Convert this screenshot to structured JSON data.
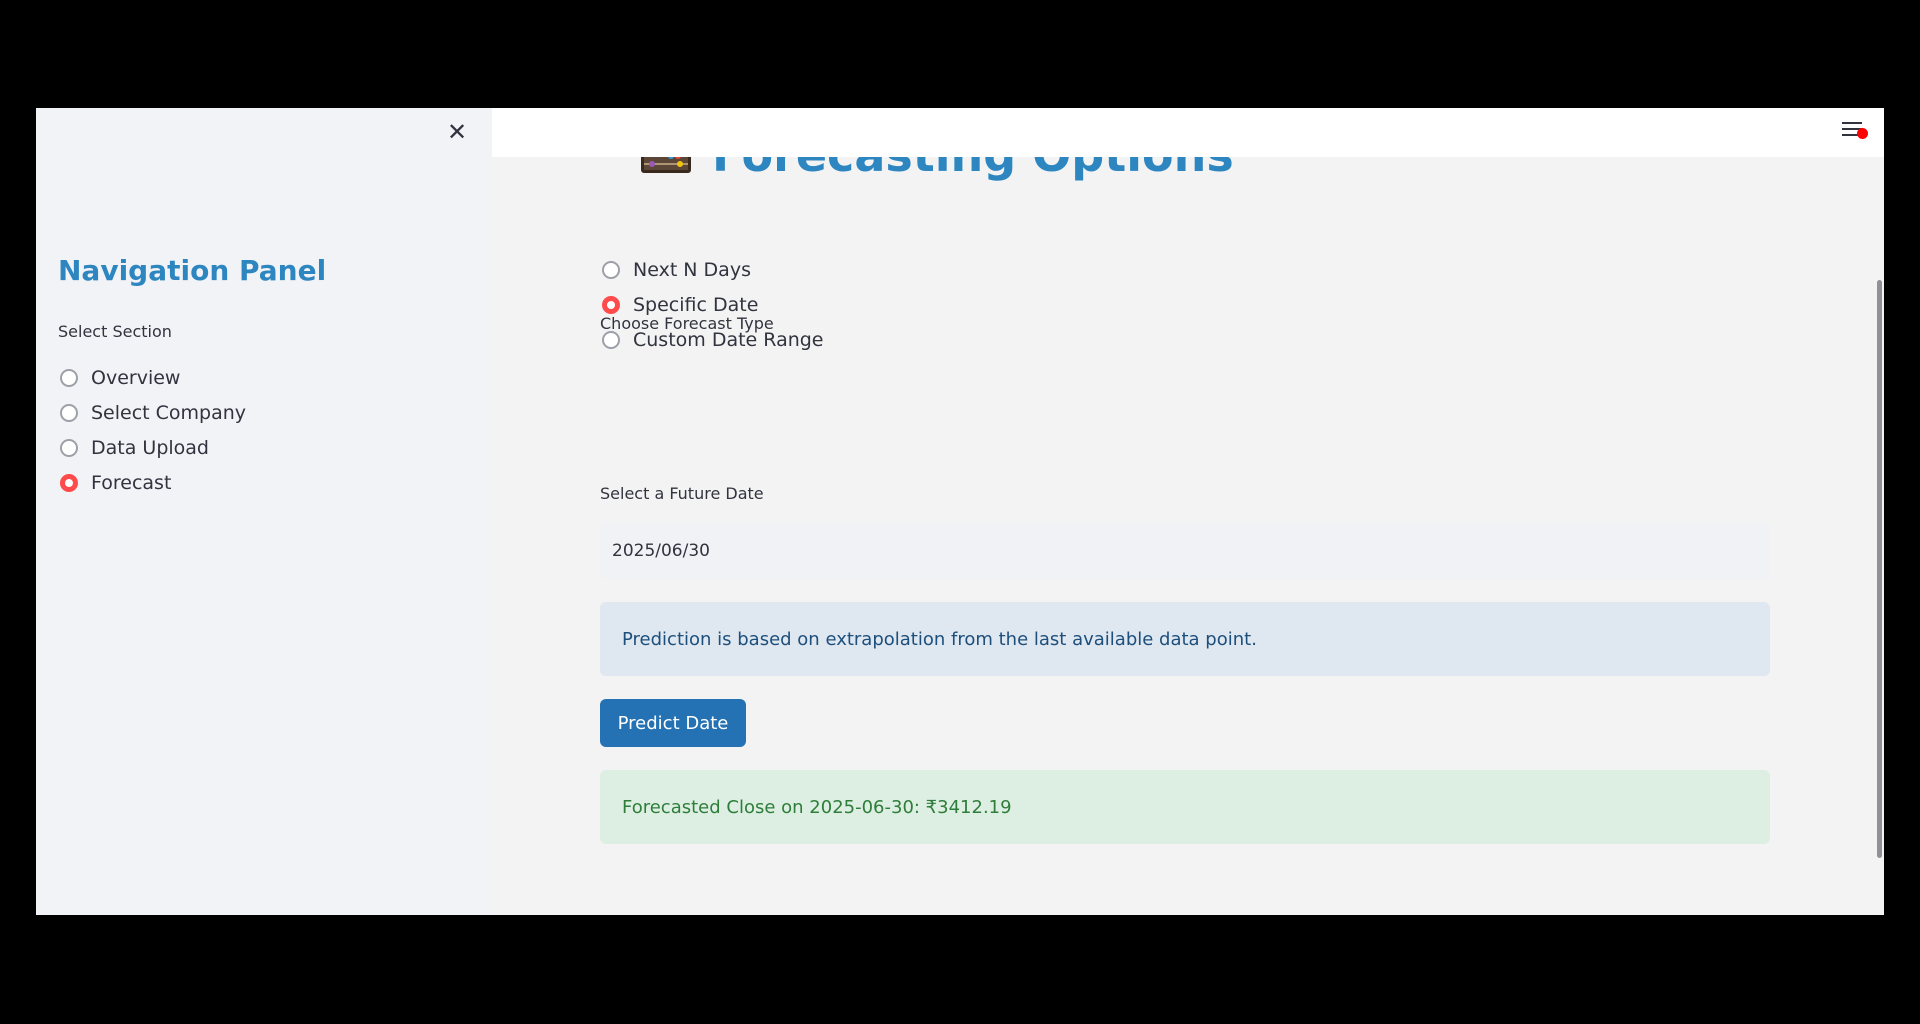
{
  "sidebar": {
    "title": "Navigation Panel",
    "select_label": "Select Section",
    "items": [
      {
        "label": "Overview",
        "selected": false
      },
      {
        "label": "Select Company",
        "selected": false
      },
      {
        "label": "Data Upload",
        "selected": false
      },
      {
        "label": "Forecast",
        "selected": true
      }
    ],
    "close_icon": "close-icon",
    "close_glyph": "✕"
  },
  "header": {
    "menu_icon": "hamburger-menu-icon",
    "notification_color": "#ff0000"
  },
  "main": {
    "title": "Forecasting Options",
    "title_icon": "abacus-icon",
    "forecast_type_label": "Choose Forecast Type",
    "forecast_types": [
      {
        "label": "Next N Days",
        "selected": false
      },
      {
        "label": "Specific Date",
        "selected": true
      },
      {
        "label": "Custom Date Range",
        "selected": false
      }
    ],
    "date_label": "Select a Future Date",
    "date_value": "2025/06/30",
    "info_message": "Prediction is based on extrapolation from the last available data point.",
    "predict_button_label": "Predict Date",
    "success_message": "Forecasted Close on 2025-06-30: ₹3412.19"
  },
  "colors": {
    "accent": "#2e86c1",
    "radio_selected": "#ff4b4b",
    "button": "#2472b3",
    "info_bg": "#dfe7f0",
    "success_bg": "#dcefe2"
  }
}
